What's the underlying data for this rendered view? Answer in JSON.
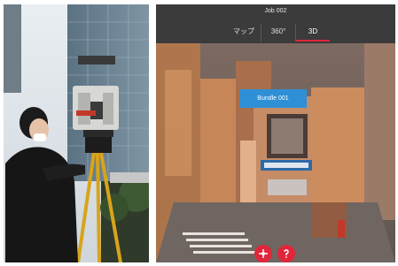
{
  "photo": {
    "description_icon": "surveyor-with-3d-scanner-photo"
  },
  "viewer": {
    "job_title": "Job 002",
    "tabs": [
      {
        "label": "マップ",
        "active": false
      },
      {
        "label": "360°",
        "active": false
      },
      {
        "label": "3D",
        "active": true
      }
    ],
    "bundle_label": "Bundle 001",
    "controls": [
      {
        "icon": "move-icon"
      },
      {
        "icon": "help-icon"
      }
    ]
  },
  "colors": {
    "accent": "#e0263a",
    "bundle": "#2f8fd6",
    "topbar": "#3b3b3b"
  }
}
